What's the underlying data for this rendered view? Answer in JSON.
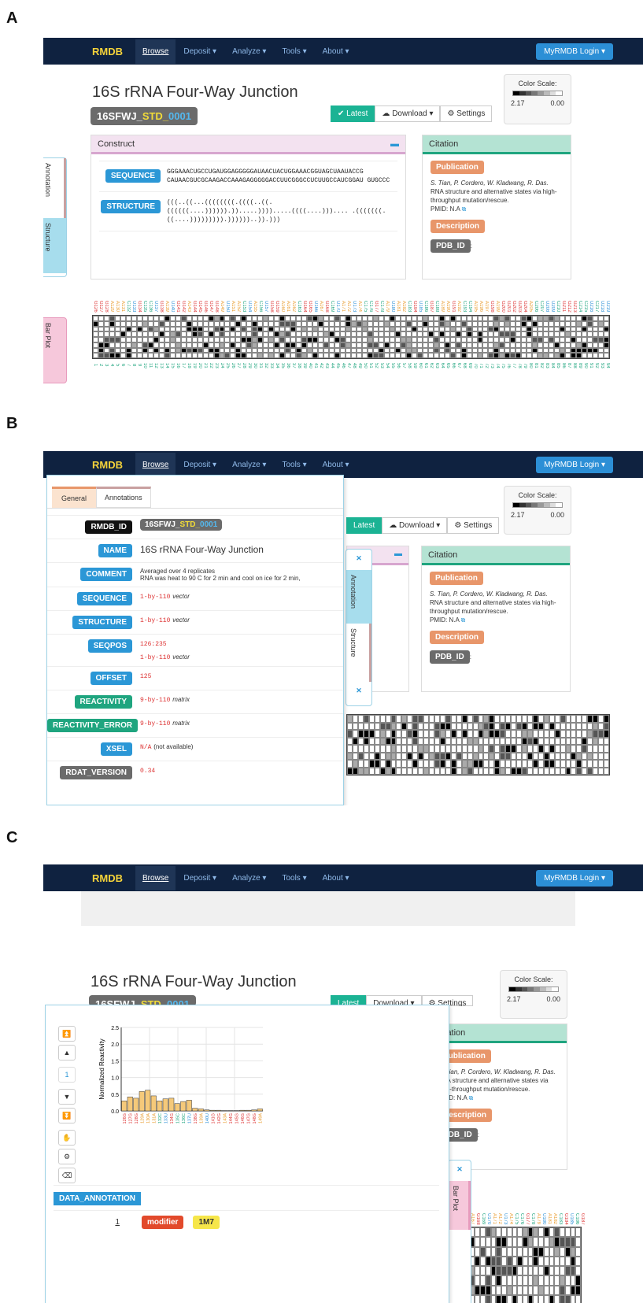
{
  "letters": {
    "a": "A",
    "b": "B",
    "c": "C"
  },
  "nav": {
    "brand": "RMDB",
    "browse": "Browse",
    "deposit": "Deposit ▾",
    "analyze": "Analyze ▾",
    "tools": "Tools ▾",
    "about": "About ▾",
    "login": "MyRMDB Login ▾"
  },
  "entry": {
    "title": "16S rRNA Four-Way Junction",
    "id_a": "16SFWJ_",
    "id_b": "STD_",
    "id_c": "0001"
  },
  "buttons": {
    "latest": "Latest",
    "download": "Download ▾",
    "settings": "Settings"
  },
  "colorscale": {
    "label": "Color Scale:",
    "max": "2.17",
    "min": "0.00",
    "colors": [
      "#000",
      "#333",
      "#555",
      "#777",
      "#999",
      "#bbb",
      "#ddd",
      "#fff"
    ]
  },
  "construct": {
    "header": "Construct",
    "seq_label": "SEQUENCE",
    "struct_label": "STRUCTURE",
    "sequence": "GGGAAACUGCCUGAUGGAGGGGGAUAACUACUGGAAACGGUAGCUAAUACCG CAUAACGUCGCAAGACCAAAGAGGGGGACCUUCGGGCCUCUUGCCAUCGGAU GUGCCC",
    "structure": "(((..((...((((((((.((((..((. ((((((....)))))).)).....)))).....((((....))).... .(((((((.((....))))))))).))))))..)).)))"
  },
  "citation": {
    "header": "Citation",
    "publication": "Publication",
    "authors": "S. Tian, P. Cordero, W. Kladwang, R. Das.",
    "paper": "RNA structure and alternative states via high-throughput mutation/rescue.",
    "pmid": "PMID: N.A",
    "description": "Description",
    "pdb": "PDB_ID"
  },
  "tabs": {
    "annotation": "Annotation",
    "structure": "Structure",
    "barplot": "Bar Plot"
  },
  "annotations": {
    "general": "General",
    "annotations": "Annotations",
    "rows": [
      {
        "k": "RMDB_ID",
        "v": "16SFWJ_STD_0001"
      },
      {
        "k": "NAME",
        "v": "16S rRNA Four-Way Junction"
      },
      {
        "k": "COMMENT",
        "v": "Averaged over 4 replicates",
        "v2": "RNA was heat to 90 C for 2 min and cool on ice for 2 min,"
      },
      {
        "k": "SEQUENCE",
        "v": "1-by-110",
        "t": "vector"
      },
      {
        "k": "STRUCTURE",
        "v": "1-by-110",
        "t": "vector"
      },
      {
        "k": "SEQPOS",
        "v": "126:235",
        "v2": "1-by-110",
        "t": "vector"
      },
      {
        "k": "OFFSET",
        "v": "125"
      },
      {
        "k": "REACTIVITY",
        "v": "9-by-110",
        "t": "matrix"
      },
      {
        "k": "REACTIVITY_ERROR",
        "v": "9-by-110",
        "t": "matrix"
      },
      {
        "k": "XSEL",
        "v": "N/A",
        "t": "(not available)"
      },
      {
        "k": "RDAT_VERSION",
        "v": "0.34"
      }
    ]
  },
  "barplot": {
    "page": "1",
    "data_annotation": "DATA_ANNOTATION",
    "row_num": "1",
    "modifier": "modifier",
    "modval": "1M7"
  },
  "chart_data": {
    "type": "bar",
    "ylabel": "Normalized Reactivity",
    "ylim": [
      0,
      2.5
    ],
    "yticks": [
      "0.0",
      "0.5",
      "1.0",
      "1.5",
      "2.0",
      "2.5"
    ],
    "categories": [
      "126G",
      "127G",
      "128G",
      "129A",
      "130A",
      "131A",
      "132C",
      "133U",
      "134G",
      "135C",
      "136C",
      "137U",
      "138G",
      "139A",
      "140U",
      "141G",
      "142G",
      "143A",
      "144G",
      "145G",
      "146G",
      "147G",
      "148G",
      "149A"
    ],
    "values": [
      0.3,
      0.42,
      0.38,
      0.58,
      0.62,
      0.45,
      0.3,
      0.36,
      0.38,
      0.22,
      0.28,
      0.32,
      0.08,
      0.06,
      0.03,
      0.02,
      0.02,
      0.01,
      0.01,
      0.01,
      0.02,
      0.02,
      0.03,
      0.06
    ]
  }
}
